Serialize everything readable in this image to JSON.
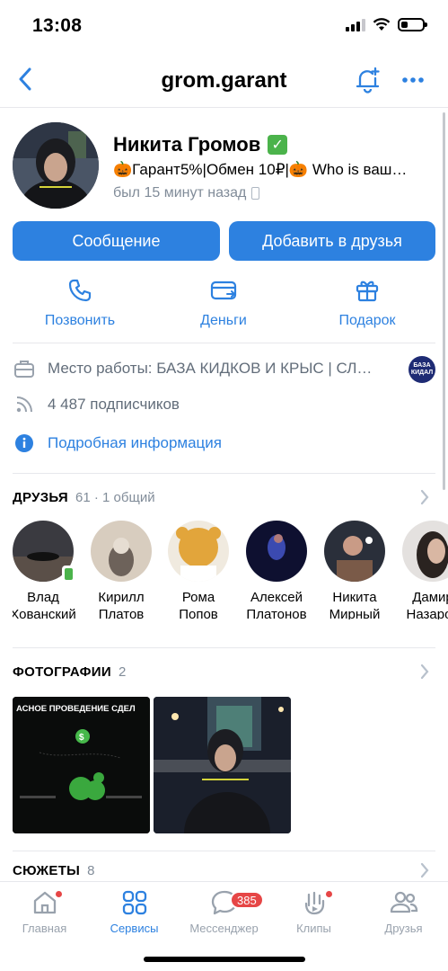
{
  "status_bar": {
    "time": "13:08"
  },
  "header": {
    "title": "grom.garant"
  },
  "profile": {
    "name": "Никита Громов",
    "status": "🎃Гарант5%|Обмен 10₽|🎃 Who is ваш…",
    "last_seen": "был 15 минут назад"
  },
  "buttons": {
    "message": "Сообщение",
    "add_friend": "Добавить в друзья"
  },
  "actions": {
    "call": "Позвонить",
    "money": "Деньги",
    "gift": "Подарок"
  },
  "info": {
    "work": "Место работы: БАЗА КИДКОВ И КРЫС | СЛ…",
    "work_logo_text": "БАЗА КИДАЛ",
    "followers": "4 487 подписчиков",
    "details": "Подробная информация"
  },
  "friends_section": {
    "title": "ДРУЗЬЯ",
    "count": "61 · 1 общий",
    "friends": [
      {
        "first": "Влад",
        "last": "Хованский"
      },
      {
        "first": "Кирилл",
        "last": "Платов"
      },
      {
        "first": "Рома",
        "last": "Попов"
      },
      {
        "first": "Алексей",
        "last": "Платонов"
      },
      {
        "first": "Никита",
        "last": "Мирный"
      },
      {
        "first": "Дамир",
        "last": "Назаров"
      }
    ]
  },
  "photos_section": {
    "title": "ФОТОГРАФИИ",
    "count": "2",
    "photo1_headline": "АСНОЕ ПРОВЕДЕНИЕ СДЕЛ"
  },
  "stories_section": {
    "title": "СЮЖЕТЫ",
    "count": "8"
  },
  "tabbar": {
    "home": "Главная",
    "services": "Сервисы",
    "messenger": "Мессенджер",
    "messenger_badge": "385",
    "clips": "Клипы",
    "friends": "Друзья"
  },
  "colors": {
    "accent": "#2d81e0",
    "verified": "#4bb34b",
    "badge": "#e64646",
    "muted": "#818c99"
  },
  "icons": [
    "back-arrow-icon",
    "bell-plus-icon",
    "more-icon",
    "verified-icon",
    "phone-icon",
    "card-icon",
    "gift-icon",
    "briefcase-icon",
    "rss-icon",
    "info-icon",
    "chevron-right-icon",
    "home-icon",
    "services-icon",
    "messenger-icon",
    "clips-icon",
    "friends-icon"
  ]
}
